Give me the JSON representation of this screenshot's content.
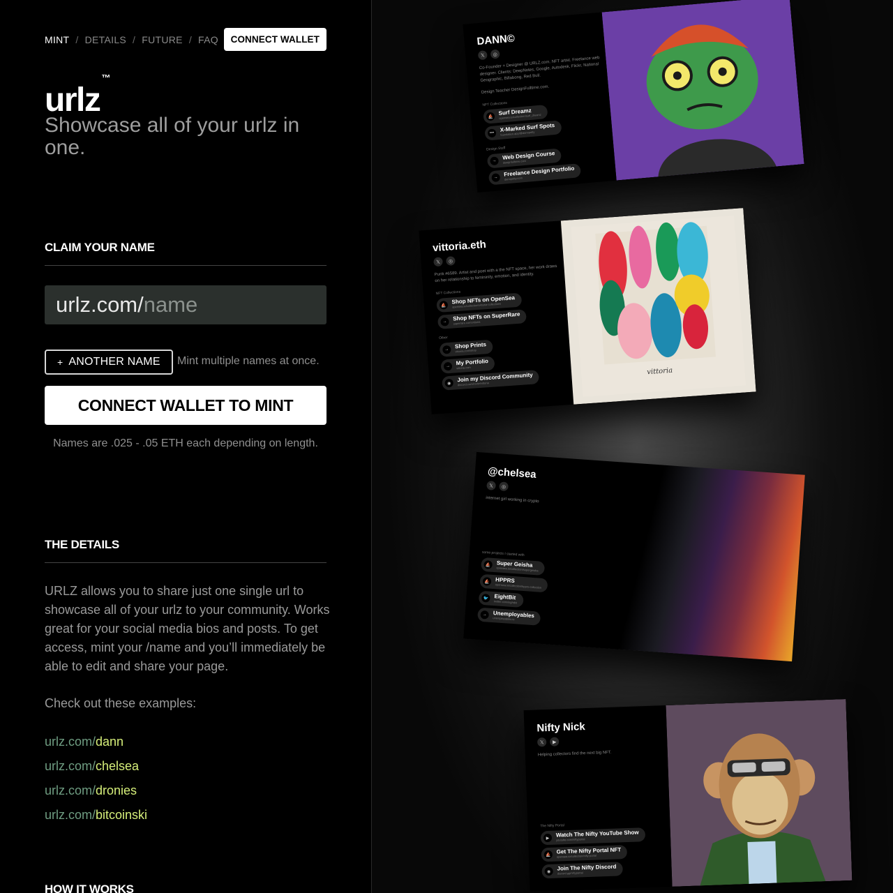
{
  "nav": {
    "items": [
      "MINT",
      "DETAILS",
      "FUTURE",
      "FAQ"
    ],
    "separator": "/",
    "connect_wallet": "CONNECT WALLET"
  },
  "brand": {
    "logo": "urlz",
    "tm": "™",
    "tagline": "Showcase all of your urlz in one."
  },
  "claim": {
    "heading": "CLAIM YOUR NAME",
    "prefix": "urlz.com/",
    "placeholder": "name",
    "another_plus": "+",
    "another_label": "ANOTHER NAME",
    "another_hint": "Mint multiple names at once.",
    "mint_button": "CONNECT WALLET TO MINT",
    "price_note": "Names are .025 - .05 ETH each depending on length."
  },
  "details": {
    "heading": "THE DETAILS",
    "paragraph": "URLZ allows you to share just one single url to showcase all of your urlz to your community. Works great for your social media bios and posts. To get access, mint your /name and you’ll immediately be able to edit and share your page.",
    "examples_heading": "Check out these examples:",
    "examples": [
      {
        "prefix": "urlz.com/",
        "name": "dann"
      },
      {
        "prefix": "urlz.com/",
        "name": "chelsea"
      },
      {
        "prefix": "urlz.com/",
        "name": "dronies"
      },
      {
        "prefix": "urlz.com/",
        "name": "bitcoinski"
      }
    ]
  },
  "how": {
    "heading": "HOW IT WORKS"
  },
  "colors": {
    "input_bg": "#2b302d",
    "link_prefix": "#6f9d82",
    "link_name": "#d6ef7a",
    "dann_art_bg": "#6b3fa6",
    "nick_art_bg": "#5e4b5e"
  },
  "cards": {
    "dann": {
      "name": "DANN©",
      "bio": "Co-Founder + Designer @ URLZ.com. NFT artist. Freelance web designer. Clients: DeepNotes, Google, Autodesk, Flickr, National Geographic, Billabong, Red Bull.",
      "bio2": "Design Teacher DesignFulltime.com.",
      "groups": [
        {
          "title": "NFT Collections",
          "links": [
            {
              "icon": "opensea-icon",
              "glyph": "⛵",
              "text": "Surf Dreamz",
              "url": "opensea.io/collection/surf_dreamz"
            },
            {
              "icon": "dots-icon",
              "glyph": "•••",
              "text": "X-Marked Surf Spots",
              "url": "foundation.app/@dannpetty"
            }
          ]
        },
        {
          "title": "Design Stuff",
          "links": [
            {
              "icon": "arrow-icon",
              "glyph": "→",
              "text": "Web Design Course",
              "url": "designfulltime.com"
            },
            {
              "icon": "arrow-icon",
              "glyph": "→",
              "text": "Freelance Design Portfolio",
              "url": "dannpetty.com"
            }
          ]
        }
      ]
    },
    "vittoria": {
      "name": "vittoria.eth",
      "bio": "Punk #6589. Artist and poet with a the NFT space, her work draws on her relationship to femininity, emotion, and identity.",
      "groups": [
        {
          "title": "NFT Collections",
          "links": [
            {
              "icon": "opensea-icon",
              "glyph": "⛵",
              "text": "Shop NFTs on OpenSea",
              "url": "opensea.io/collection/vittoria-collections"
            },
            {
              "icon": "arrow-icon",
              "glyph": "→",
              "text": "Shop NFTs on SuperRare",
              "url": "superrare.com/vittoria"
            }
          ]
        },
        {
          "title": "Other",
          "links": [
            {
              "icon": "arrow-icon",
              "glyph": "→",
              "text": "Shop Prints",
              "url": "vittoria.com/shop"
            },
            {
              "icon": "arrow-icon",
              "glyph": "→",
              "text": "My Portfolio",
              "url": "vittoria.com"
            },
            {
              "icon": "discord-icon",
              "glyph": "◉",
              "text": "Join my Discord Community",
              "url": "discord.com/invite/vittoria"
            }
          ]
        }
      ],
      "signature": "vittoria"
    },
    "chelsea": {
      "name": "@chelsea",
      "bio": "internet girl working in crypto",
      "groups": [
        {
          "title": "some projects I started with",
          "links": [
            {
              "icon": "opensea-icon",
              "glyph": "⛵",
              "text": "Super Geisha",
              "url": "opensea.io/collection/supergeisha"
            },
            {
              "icon": "opensea-icon",
              "glyph": "⛵",
              "text": "HPPRS",
              "url": "opensea.io/collection/hpprs-collection"
            },
            {
              "icon": "twitter-icon",
              "glyph": "🐦",
              "text": "EightBit",
              "url": "twitter.com/eightbit"
            },
            {
              "icon": "arrow-icon",
              "glyph": "→",
              "text": "Unemployables",
              "url": "unemployables.io"
            }
          ]
        }
      ]
    },
    "nick": {
      "name": "Nifty Nick",
      "bio": "Helping collectors find the next big NFT.",
      "groups": [
        {
          "title": "The Nifty Portal",
          "links": [
            {
              "icon": "youtube-icon",
              "glyph": "▶",
              "text": "Watch The Nifty YouTube Show",
              "url": "youtube.com/niftyportal"
            },
            {
              "icon": "opensea-icon",
              "glyph": "⛵",
              "text": "Get The Nifty Portal NFT",
              "url": "opensea.io/collection/nifty-portal"
            },
            {
              "icon": "discord-icon",
              "glyph": "◉",
              "text": "Join The Nifty Discord",
              "url": "discord.gg/niftyportal"
            }
          ]
        }
      ]
    }
  }
}
